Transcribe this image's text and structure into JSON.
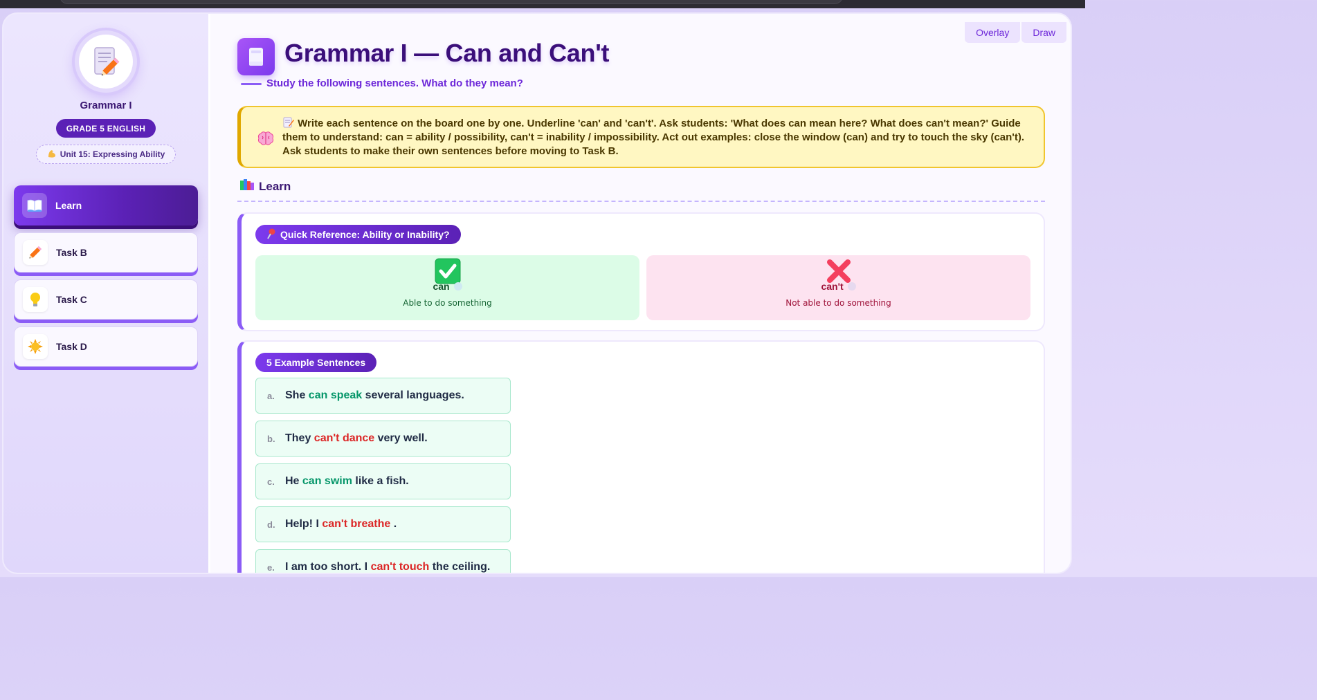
{
  "toolbar": {
    "overlay_label": "Overlay",
    "draw_label": "Draw"
  },
  "sidebar": {
    "title": "Grammar I",
    "grade_badge": "GRADE 5 ENGLISH",
    "unit_badge": "Unit 15: Expressing Ability",
    "items": [
      {
        "label": "Learn",
        "icon": "book-icon",
        "active": true
      },
      {
        "label": "Task B",
        "icon": "pencil-icon",
        "active": false
      },
      {
        "label": "Task C",
        "icon": "lightbulb-icon",
        "active": false
      },
      {
        "label": "Task D",
        "icon": "sun-icon",
        "active": false
      }
    ]
  },
  "main": {
    "title": "Grammar I — Can and Can't",
    "subtitle": "Study the following sentences. What do they mean?",
    "teacher_note": "Write each sentence on the board one by one. Underline 'can' and 'can't'. Ask students: 'What does can mean here? What does can't mean?' Guide them to understand: can = ability / possibility, can't = inability / impossibility. Act out examples: close the window (can) and try to touch the sky (can't). Ask students to make their own sentences before moving to Task B.",
    "section_heading": "Learn",
    "quick_ref": {
      "title": "Quick Reference: Ability or Inability?",
      "can": {
        "word": "can",
        "description": "Able to do something",
        "color": "#14532d",
        "bg": "#dcfce7"
      },
      "cant": {
        "word": "can't",
        "description": "Not able to do something",
        "color": "#9f1239",
        "bg": "#fde3f0"
      }
    },
    "examples": {
      "title": "5 Example Sentences",
      "items": [
        {
          "letter": "a.",
          "before": "She ",
          "highlight": "can speak",
          "type": "can",
          "after": " several languages."
        },
        {
          "letter": "b.",
          "before": "They ",
          "highlight": "can't dance",
          "type": "cant",
          "after": " very well."
        },
        {
          "letter": "c.",
          "before": "He ",
          "highlight": "can swim",
          "type": "can",
          "after": " like a fish."
        },
        {
          "letter": "d.",
          "before": "Help! I ",
          "highlight": "can't breathe",
          "type": "cant",
          "after": " ."
        },
        {
          "letter": "e.",
          "before": "I am too short. I ",
          "highlight": "can't touch",
          "type": "cant",
          "after": " the ceiling."
        }
      ]
    }
  },
  "colors": {
    "accent": "#7c3aed",
    "accent_dark": "#4c1d95",
    "note_bg": "#fff7c2",
    "can_green": "#059669",
    "cant_red": "#dc2626"
  }
}
